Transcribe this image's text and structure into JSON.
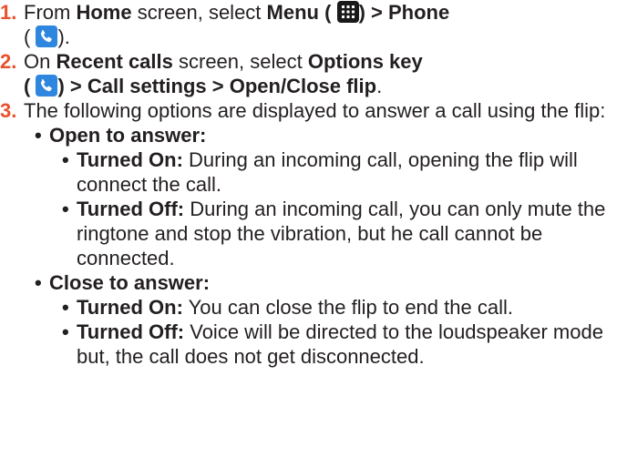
{
  "steps": [
    {
      "number": "1.",
      "t1": "From ",
      "home": "Home",
      "t2": " screen, select ",
      "menu": "Menu",
      "t3": " (",
      "t4": ") > Phone",
      "t5": "(",
      "t6": ")."
    },
    {
      "number": "2.",
      "t1": "On ",
      "recent": "Recent calls",
      "t2": " screen, select ",
      "options": "Options key",
      "t3": "(",
      "t4": ") > Call settings > Open/Close flip",
      "t5": "."
    },
    {
      "number": "3.",
      "text": "The following options are displayed to answer a call using the flip:"
    }
  ],
  "options_list": [
    {
      "heading": "Open to answer:",
      "items": [
        {
          "label": "Turned On:",
          "text": " During an incoming call, opening the flip will connect the call."
        },
        {
          "label": "Turned Off:",
          "text": " During an incoming call, you can only mute the ringtone and stop the vibration, but he call cannot be connected."
        }
      ]
    },
    {
      "heading": "Close to answer:",
      "items": [
        {
          "label": "Turned On:",
          "text": " You can close the flip to end the call."
        },
        {
          "label": "Turned Off:",
          "text": " Voice will be directed to the loudspeaker mode but, the call does not get disconnected."
        }
      ]
    }
  ],
  "bullet": "•",
  "icons": {
    "menu": "menu-grid-icon",
    "phone": "phone-handset-icon",
    "phone_color": "#2e86de",
    "accent": "#e8512e"
  }
}
